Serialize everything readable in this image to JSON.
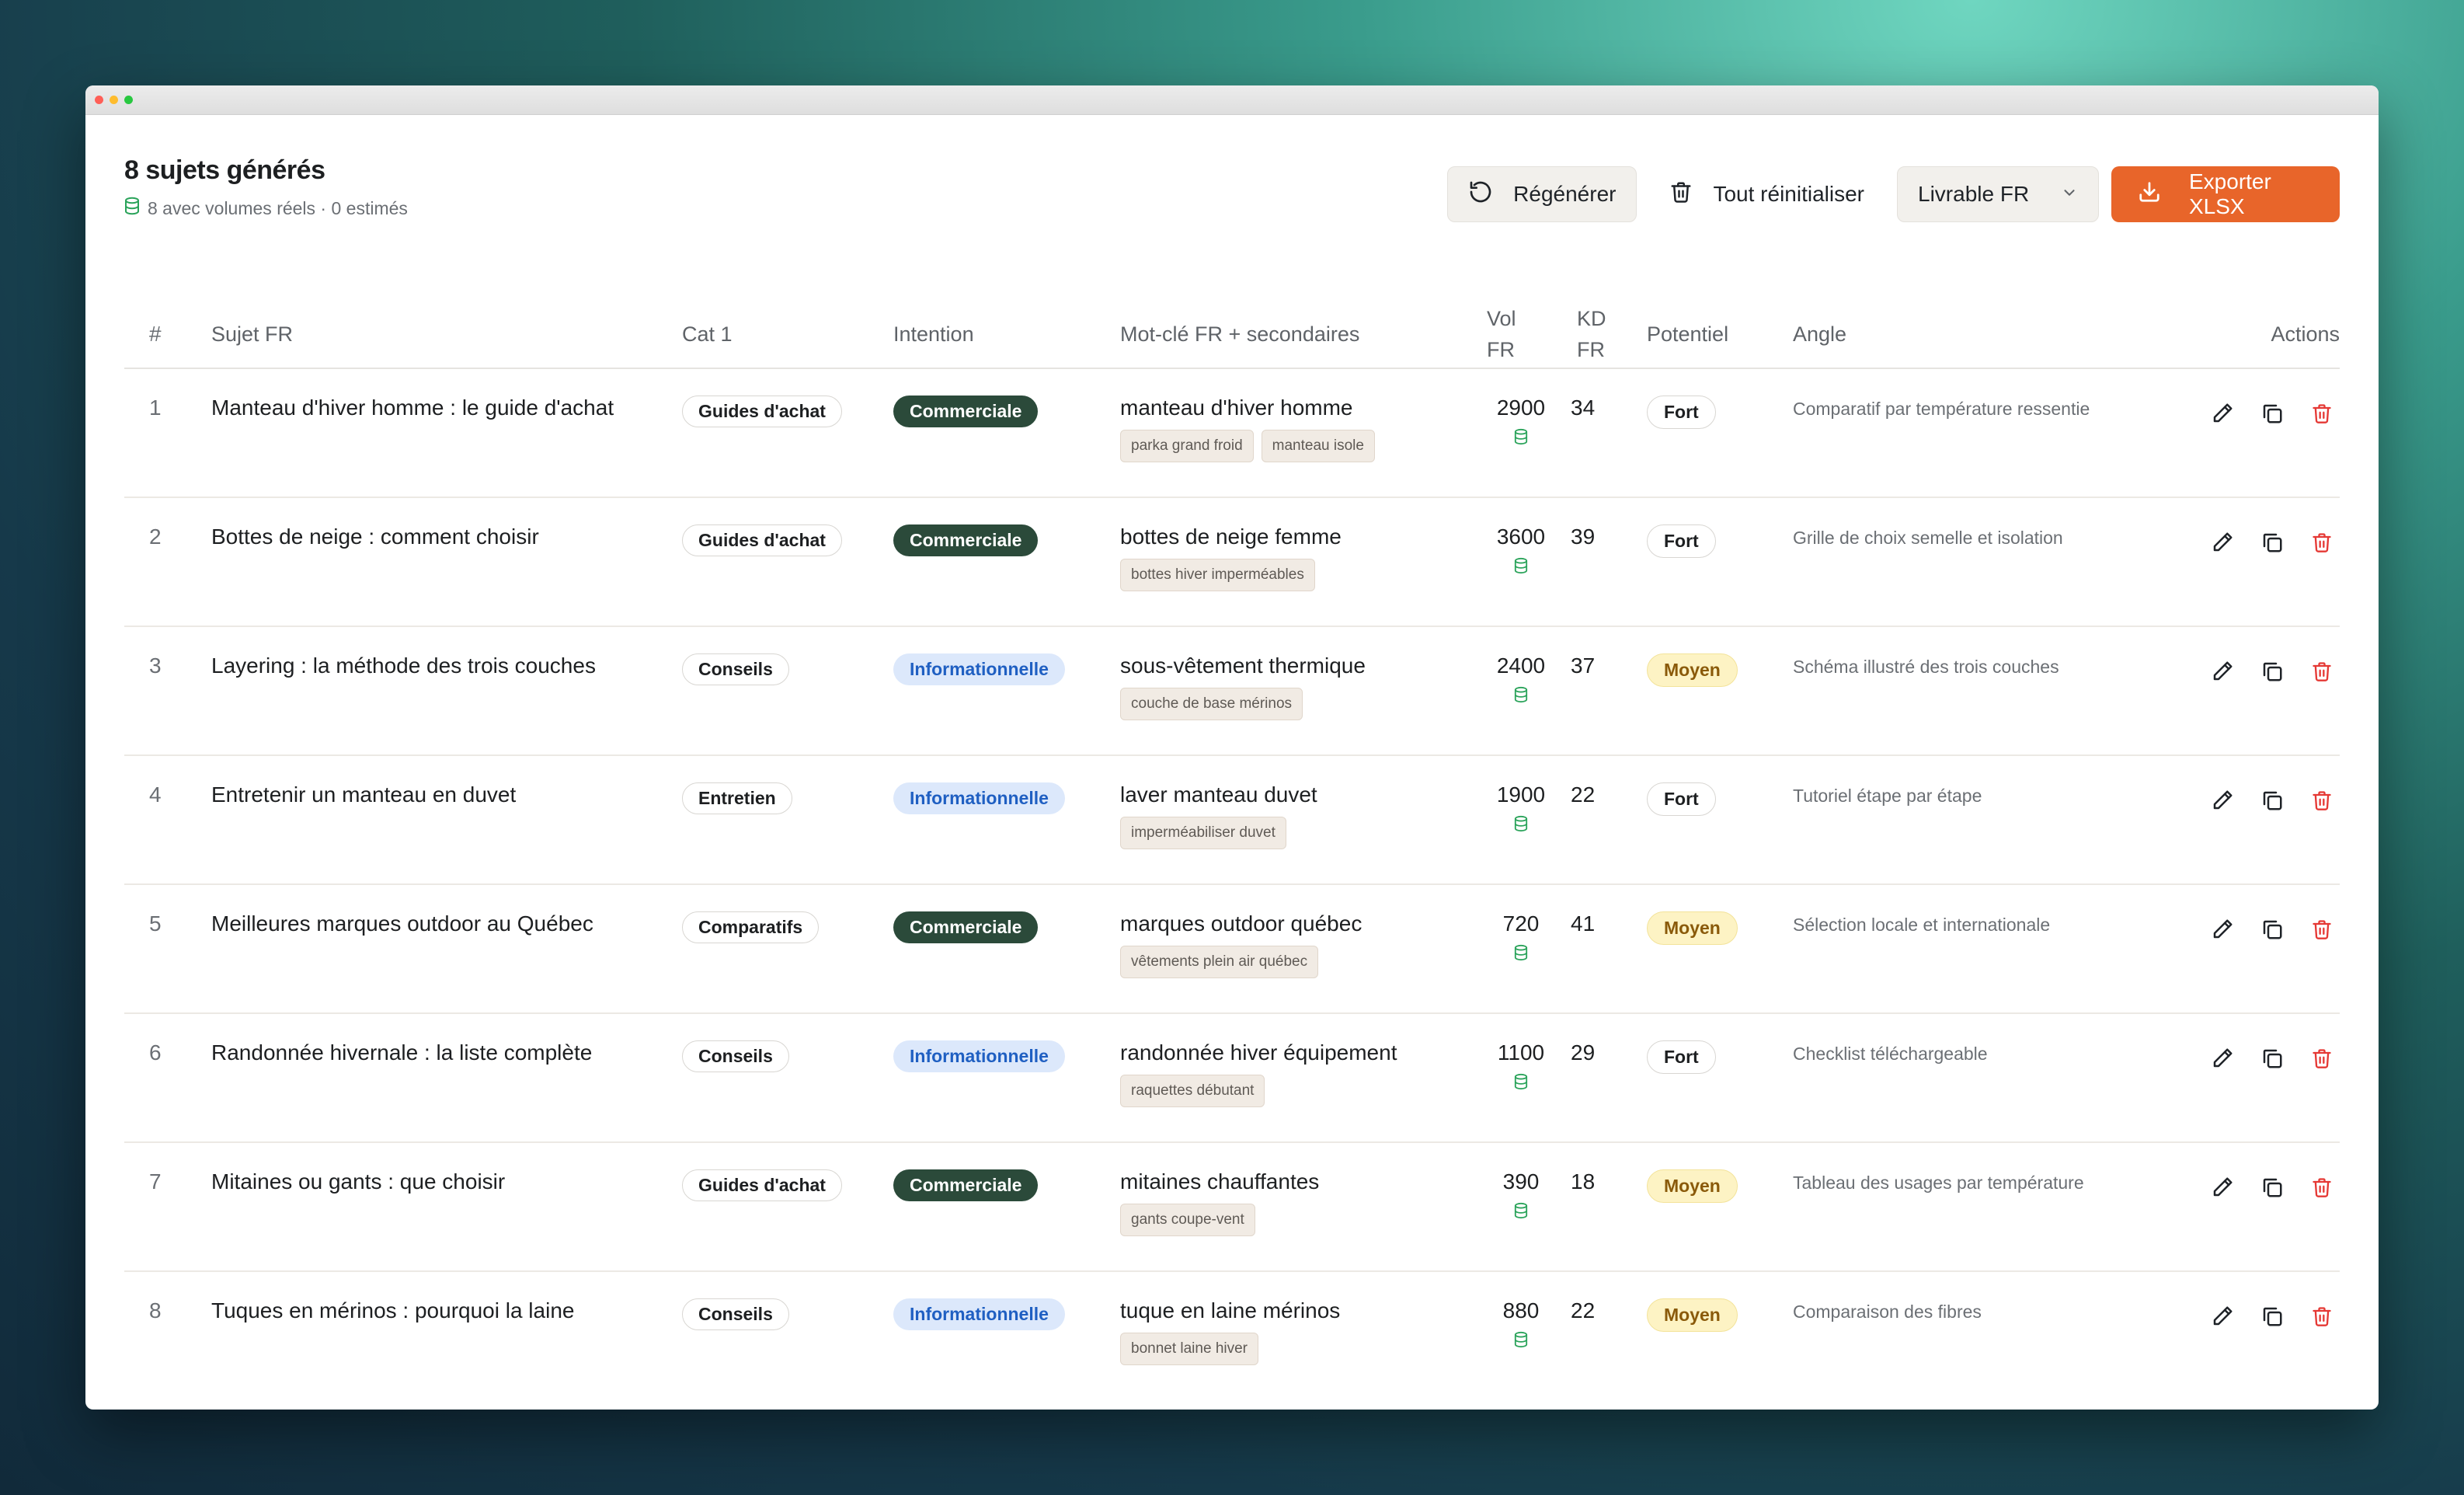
{
  "header": {
    "title": "8 sujets générés",
    "subtitle": "8 avec volumes réels · 0 estimés"
  },
  "toolbar": {
    "regenerate_label": "Régénérer",
    "reset_label": "Tout réinitialiser",
    "select_value": "Livrable FR",
    "export_label": "Exporter XLSX"
  },
  "colors": {
    "accent": "#e8652a",
    "commerciale": "#2b4a3a",
    "informationnelle": "#dce8fb",
    "moyen": "#fdf3c4",
    "database": "#2aa35a",
    "delete": "#e53935"
  },
  "table": {
    "headers": {
      "num": "#",
      "subject": "Sujet FR",
      "cat": "Cat 1",
      "intent": "Intention",
      "keyword": "Mot-clé FR + secondaires",
      "vol_line1": "Vol",
      "vol_line2": "FR",
      "kd_line1": "KD",
      "kd_line2": "FR",
      "potential": "Potentiel",
      "angle": "Angle",
      "actions": "Actions"
    },
    "rows": [
      {
        "num": "1",
        "subject": "Manteau d'hiver homme : le guide d'achat",
        "cat": "Guides d'achat",
        "intent": "Commerciale",
        "keyword": "manteau d'hiver homme",
        "tag1": "parka grand froid",
        "tag2": "manteau isole",
        "vol": "2900",
        "kd": "34",
        "potential": "Fort",
        "angle": "Comparatif par température ressentie"
      },
      {
        "num": "2",
        "subject": "Bottes de neige : comment choisir",
        "cat": "Guides d'achat",
        "intent": "Commerciale",
        "keyword": "bottes de neige femme",
        "tag1": "bottes hiver imperméables",
        "vol": "3600",
        "kd": "39",
        "potential": "Fort",
        "angle": "Grille de choix semelle et isolation"
      },
      {
        "num": "3",
        "subject": "Layering : la méthode des trois couches",
        "cat": "Conseils",
        "intent": "Informationnelle",
        "keyword": "sous-vêtement thermique",
        "tag1": "couche de base mérinos",
        "vol": "2400",
        "kd": "37",
        "potential": "Moyen",
        "angle": "Schéma illustré des trois couches"
      },
      {
        "num": "4",
        "subject": "Entretenir un manteau en duvet",
        "cat": "Entretien",
        "intent": "Informationnelle",
        "keyword": "laver manteau duvet",
        "tag1": "imperméabiliser duvet",
        "vol": "1900",
        "kd": "22",
        "potential": "Fort",
        "angle": "Tutoriel étape par étape"
      },
      {
        "num": "5",
        "subject": "Meilleures marques outdoor au Québec",
        "cat": "Comparatifs",
        "intent": "Commerciale",
        "keyword": "marques outdoor québec",
        "tag1": "vêtements plein air québec",
        "vol": "720",
        "kd": "41",
        "potential": "Moyen",
        "angle": "Sélection locale et internationale"
      },
      {
        "num": "6",
        "subject": "Randonnée hivernale : la liste complète",
        "cat": "Conseils",
        "intent": "Informationnelle",
        "keyword": "randonnée hiver équipement",
        "tag1": "raquettes débutant",
        "vol": "1100",
        "kd": "29",
        "potential": "Fort",
        "angle": "Checklist téléchargeable"
      },
      {
        "num": "7",
        "subject": "Mitaines ou gants : que choisir",
        "cat": "Guides d'achat",
        "intent": "Commerciale",
        "keyword": "mitaines chauffantes",
        "tag1": "gants coupe-vent",
        "vol": "390",
        "kd": "18",
        "potential": "Moyen",
        "angle": "Tableau des usages par température"
      },
      {
        "num": "8",
        "subject": "Tuques en mérinos : pourquoi la laine",
        "cat": "Conseils",
        "intent": "Informationnelle",
        "keyword": "tuque en laine mérinos",
        "tag1": "bonnet laine hiver",
        "vol": "880",
        "kd": "22",
        "potential": "Moyen",
        "angle": "Comparaison des fibres"
      }
    ]
  }
}
